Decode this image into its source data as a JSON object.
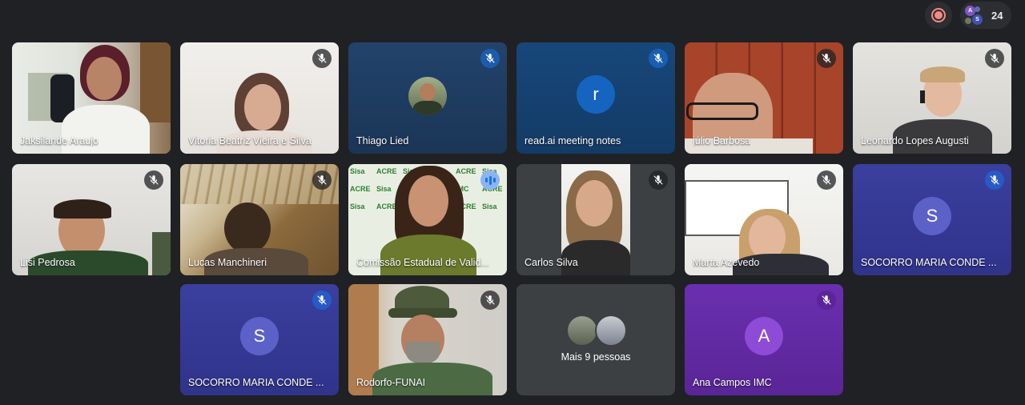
{
  "meeting": {
    "participant_count": "24",
    "record_icon": "record-icon",
    "people_icon": "people-avatars-icon"
  },
  "tiles": [
    {
      "name": "Jaksilande Araujo",
      "muted": false
    },
    {
      "name": "Vitoria Beatriz Vieira e Silva",
      "muted": true
    },
    {
      "name": "Thiago Lied",
      "muted": true
    },
    {
      "name": "read.ai meeting notes",
      "muted": true,
      "initial": "r"
    },
    {
      "name": "júlio Barbosa",
      "muted": true
    },
    {
      "name": "Leonardo Lopes Augusti",
      "muted": true
    },
    {
      "name": "Lisi Pedrosa",
      "muted": true
    },
    {
      "name": "Lucas Manchineri",
      "muted": true
    },
    {
      "name": "Comissão Estadual de Valid...",
      "muted": false,
      "speaking": true
    },
    {
      "name": "Carlos Silva",
      "muted": true
    },
    {
      "name": "Marta Azevedo",
      "muted": true
    },
    {
      "name": "SOCORRO MARIA CONDE ...",
      "muted": true,
      "initial": "S"
    },
    {
      "name": "SOCORRO MARIA CONDE ...",
      "muted": true,
      "initial": "S"
    },
    {
      "name": "Rodorfo-FUNAI",
      "muted": true
    },
    {
      "name": "Mais 9 pessoas",
      "muted": false
    },
    {
      "name": "Ana Campos IMC",
      "muted": true,
      "initial": "A"
    }
  ],
  "colors": {
    "background": "#202124",
    "tile_dark": "#3c4043",
    "tile_blue": "#1e3a5f",
    "tile_indigo": "#3b3f9e",
    "tile_purple": "#6a2fb0",
    "speaking": "#8ab4f8",
    "recording": "#f28b82"
  },
  "banner_text": {
    "acre": "ACRE",
    "sisa": "Sisa",
    "imc": "IMC"
  }
}
